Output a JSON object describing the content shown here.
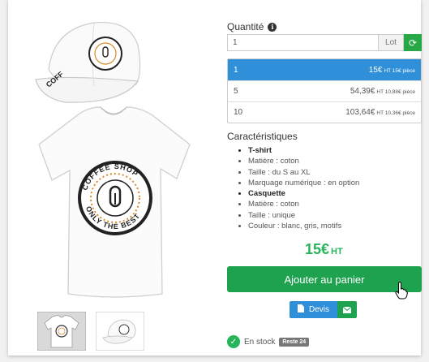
{
  "quantity": {
    "label": "Quantité",
    "value": "1",
    "unit": "Lot"
  },
  "price_tiers": [
    {
      "qty": "1",
      "price": "15€",
      "detail": "HT 15€ pièce",
      "selected": true
    },
    {
      "qty": "5",
      "price": "54,39€",
      "detail": "HT 10,88€ pièce",
      "selected": false
    },
    {
      "qty": "10",
      "price": "103,64€",
      "detail": "HT 10,36€ pièce",
      "selected": false
    }
  ],
  "specs": {
    "title": "Caractéristiques",
    "items": [
      {
        "text": "T-shirt",
        "bold": true
      },
      {
        "text": "Matière : coton",
        "bold": false
      },
      {
        "text": "Taille : du S au XL",
        "bold": false
      },
      {
        "text": "Marquage numérique : en option",
        "bold": false
      },
      {
        "text": "Casquette",
        "bold": true
      },
      {
        "text": "Matière : coton",
        "bold": false
      },
      {
        "text": "Taille : unique",
        "bold": false
      },
      {
        "text": "Couleur : blanc, gris, motifs",
        "bold": false
      }
    ]
  },
  "price": {
    "amount": "15€",
    "suffix": "HT"
  },
  "cart_button": "Ajouter au panier",
  "devis_button": "Devis",
  "stock": {
    "label": "En stock",
    "badge": "Reste 24"
  },
  "logo": {
    "top": "COFFEE SHOP",
    "bottom": "ONLY THE BEST"
  },
  "colors": {
    "accent_blue": "#2f8fd8",
    "accent_green": "#1fa24f",
    "price_green": "#28b45a"
  }
}
